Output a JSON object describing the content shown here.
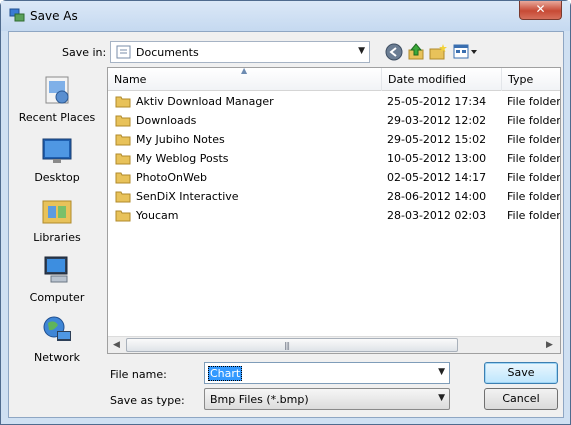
{
  "window": {
    "title": "Save As",
    "close_glyph": "✕"
  },
  "save_in": {
    "label": "Save in:",
    "value": "Documents"
  },
  "toolbar": {
    "back_icon": "back-arrow-icon",
    "up_icon": "up-folder-icon",
    "new_folder_icon": "new-folder-icon",
    "views_icon": "views-menu-icon"
  },
  "places": [
    {
      "label": "Recent Places",
      "icon": "recent-places-icon"
    },
    {
      "label": "Desktop",
      "icon": "desktop-icon"
    },
    {
      "label": "Libraries",
      "icon": "libraries-icon"
    },
    {
      "label": "Computer",
      "icon": "computer-icon"
    },
    {
      "label": "Network",
      "icon": "network-icon"
    }
  ],
  "columns": [
    "Name",
    "Date modified",
    "Type"
  ],
  "files": [
    {
      "name": "Aktiv Download Manager",
      "date": "25-05-2012 17:34",
      "type": "File folder"
    },
    {
      "name": "Downloads",
      "date": "29-03-2012 12:02",
      "type": "File folder"
    },
    {
      "name": "My Jubiho Notes",
      "date": "29-05-2012 15:02",
      "type": "File folder"
    },
    {
      "name": "My Weblog Posts",
      "date": "10-05-2012 13:00",
      "type": "File folder"
    },
    {
      "name": "PhotoOnWeb",
      "date": "02-05-2012 14:17",
      "type": "File folder"
    },
    {
      "name": "SenDiX Interactive",
      "date": "28-06-2012 14:00",
      "type": "File folder"
    },
    {
      "name": "Youcam",
      "date": "28-03-2012 02:03",
      "type": "File folder"
    }
  ],
  "file_name": {
    "label": "File name:",
    "value": "Chart"
  },
  "save_as_type": {
    "label": "Save as type:",
    "value": "Bmp Files (*.bmp)"
  },
  "buttons": {
    "save": "Save",
    "cancel": "Cancel"
  },
  "colors": {
    "folder": "#e8c25a",
    "selection": "#3399ff",
    "frame": "#cfe0f2"
  }
}
